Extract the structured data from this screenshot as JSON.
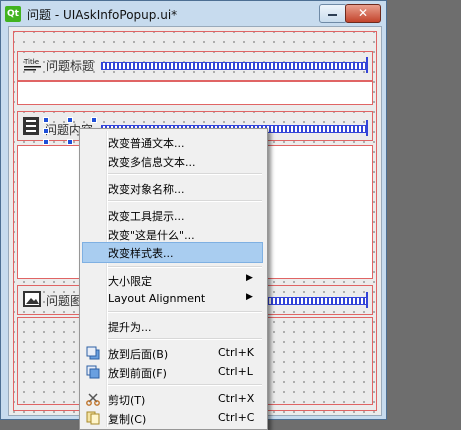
{
  "window": {
    "title": "问题 - UIAskInfoPopup.ui*",
    "logo_text": "Qt",
    "close_glyph": "✕"
  },
  "form": {
    "row1_label": "问题标题",
    "row2_label": "问题内容",
    "row3_label": "问题图"
  },
  "context_menu": {
    "items": [
      {
        "label": "改变普通文本..."
      },
      {
        "label": "改变多信息文本..."
      },
      {
        "label": "改变对象名称..."
      },
      {
        "label": "改变工具提示..."
      },
      {
        "label": "改变\"这是什么\"..."
      },
      {
        "label": "改变样式表...",
        "highlighted": true
      },
      {
        "label": "大小限定",
        "submenu": true
      },
      {
        "label": "Layout Alignment",
        "submenu": true
      },
      {
        "label": "提升为..."
      },
      {
        "label": "放到后面(B)",
        "shortcut": "Ctrl+K",
        "icon": "send-to-back-icon"
      },
      {
        "label": "放到前面(F)",
        "shortcut": "Ctrl+L",
        "icon": "bring-to-front-icon"
      },
      {
        "label": "剪切(T)",
        "shortcut": "Ctrl+X",
        "icon": "scissors-icon"
      },
      {
        "label": "复制(C)",
        "shortcut": "Ctrl+C",
        "icon": "copy-icon"
      }
    ],
    "submenu_arrow": "▶"
  },
  "colors": {
    "highlight": "#a9cdf0",
    "layout_frame": "#e06464",
    "spring": "#3344d8"
  }
}
